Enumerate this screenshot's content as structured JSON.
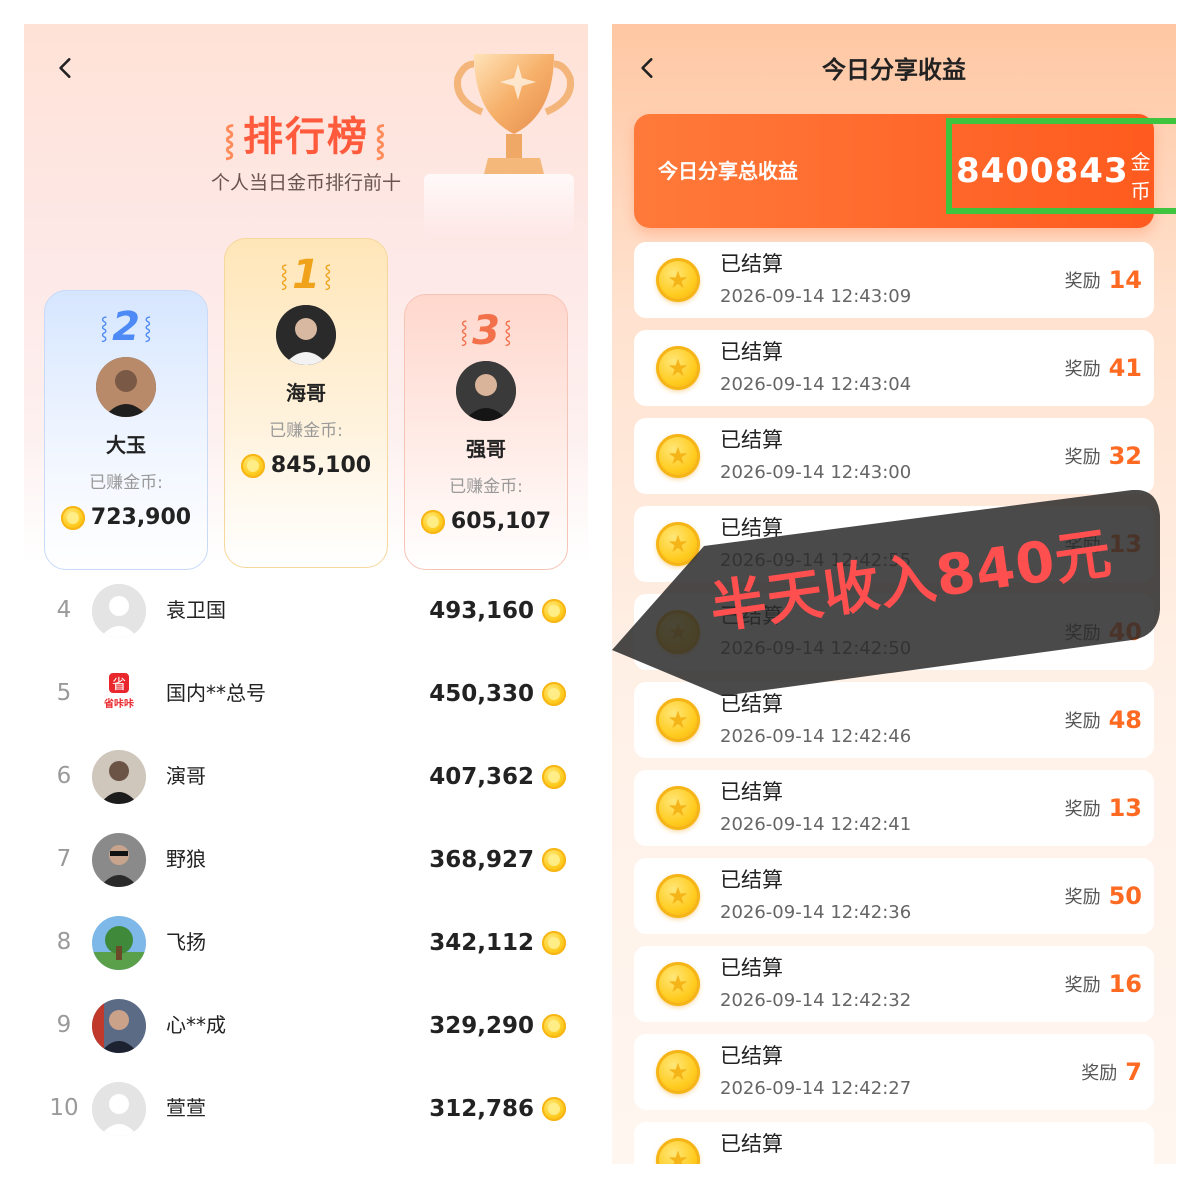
{
  "leaderboard": {
    "title": "排行榜",
    "subtitle": "个人当日金币排行前十",
    "earned_label": "已赚金币:",
    "podium": [
      {
        "rank": "2",
        "name": "大玉",
        "amount": "723,900"
      },
      {
        "rank": "1",
        "name": "海哥",
        "amount": "845,100"
      },
      {
        "rank": "3",
        "name": "强哥",
        "amount": "605,107"
      }
    ],
    "list": [
      {
        "rank": "4",
        "name": "袁卫国",
        "score": "493,160"
      },
      {
        "rank": "5",
        "name": "国内**总号",
        "score": "450,330"
      },
      {
        "rank": "6",
        "name": "演哥",
        "score": "407,362"
      },
      {
        "rank": "7",
        "name": "野狼",
        "score": "368,927"
      },
      {
        "rank": "8",
        "name": "飞扬",
        "score": "342,112"
      },
      {
        "rank": "9",
        "name": "心**成",
        "score": "329,290"
      },
      {
        "rank": "10",
        "name": "萱萱",
        "score": "312,786"
      }
    ],
    "logo_text_top": "省",
    "logo_text_bottom": "省咔咔"
  },
  "earnings": {
    "title": "今日分享收益",
    "total_label": "今日分享总收益",
    "total_value": "8400843",
    "total_unit": "金币",
    "reward_label": "奖励",
    "records": [
      {
        "status": "已结算",
        "time": "2026-09-14 12:43:09",
        "reward": "14"
      },
      {
        "status": "已结算",
        "time": "2026-09-14 12:43:04",
        "reward": "41"
      },
      {
        "status": "已结算",
        "time": "2026-09-14 12:43:00",
        "reward": "32"
      },
      {
        "status": "已结算",
        "time": "2026-09-14 12:42:55",
        "reward": "13"
      },
      {
        "status": "已结算",
        "time": "2026-09-14 12:42:50",
        "reward": "40"
      },
      {
        "status": "已结算",
        "time": "2026-09-14 12:42:46",
        "reward": "48"
      },
      {
        "status": "已结算",
        "time": "2026-09-14 12:42:41",
        "reward": "13"
      },
      {
        "status": "已结算",
        "time": "2026-09-14 12:42:36",
        "reward": "50"
      },
      {
        "status": "已结算",
        "time": "2026-09-14 12:42:32",
        "reward": "16"
      },
      {
        "status": "已结算",
        "time": "2026-09-14 12:42:27",
        "reward": "7"
      },
      {
        "status": "已结算",
        "time": "",
        "reward": ""
      }
    ],
    "banner_text": "半天收入840元"
  },
  "colors": {
    "accent_orange": "#ff5a1f",
    "highlight_green": "#3ec43e",
    "banner_red": "#ff4f4f",
    "rank1_gold": "#f0a21a",
    "rank2_blue": "#4e8af5",
    "rank3_coral": "#f2704a"
  },
  "icons": [
    "back-chevron-icon",
    "trophy-icon",
    "coin-icon",
    "laurel-icon",
    "avatar-icon"
  ]
}
